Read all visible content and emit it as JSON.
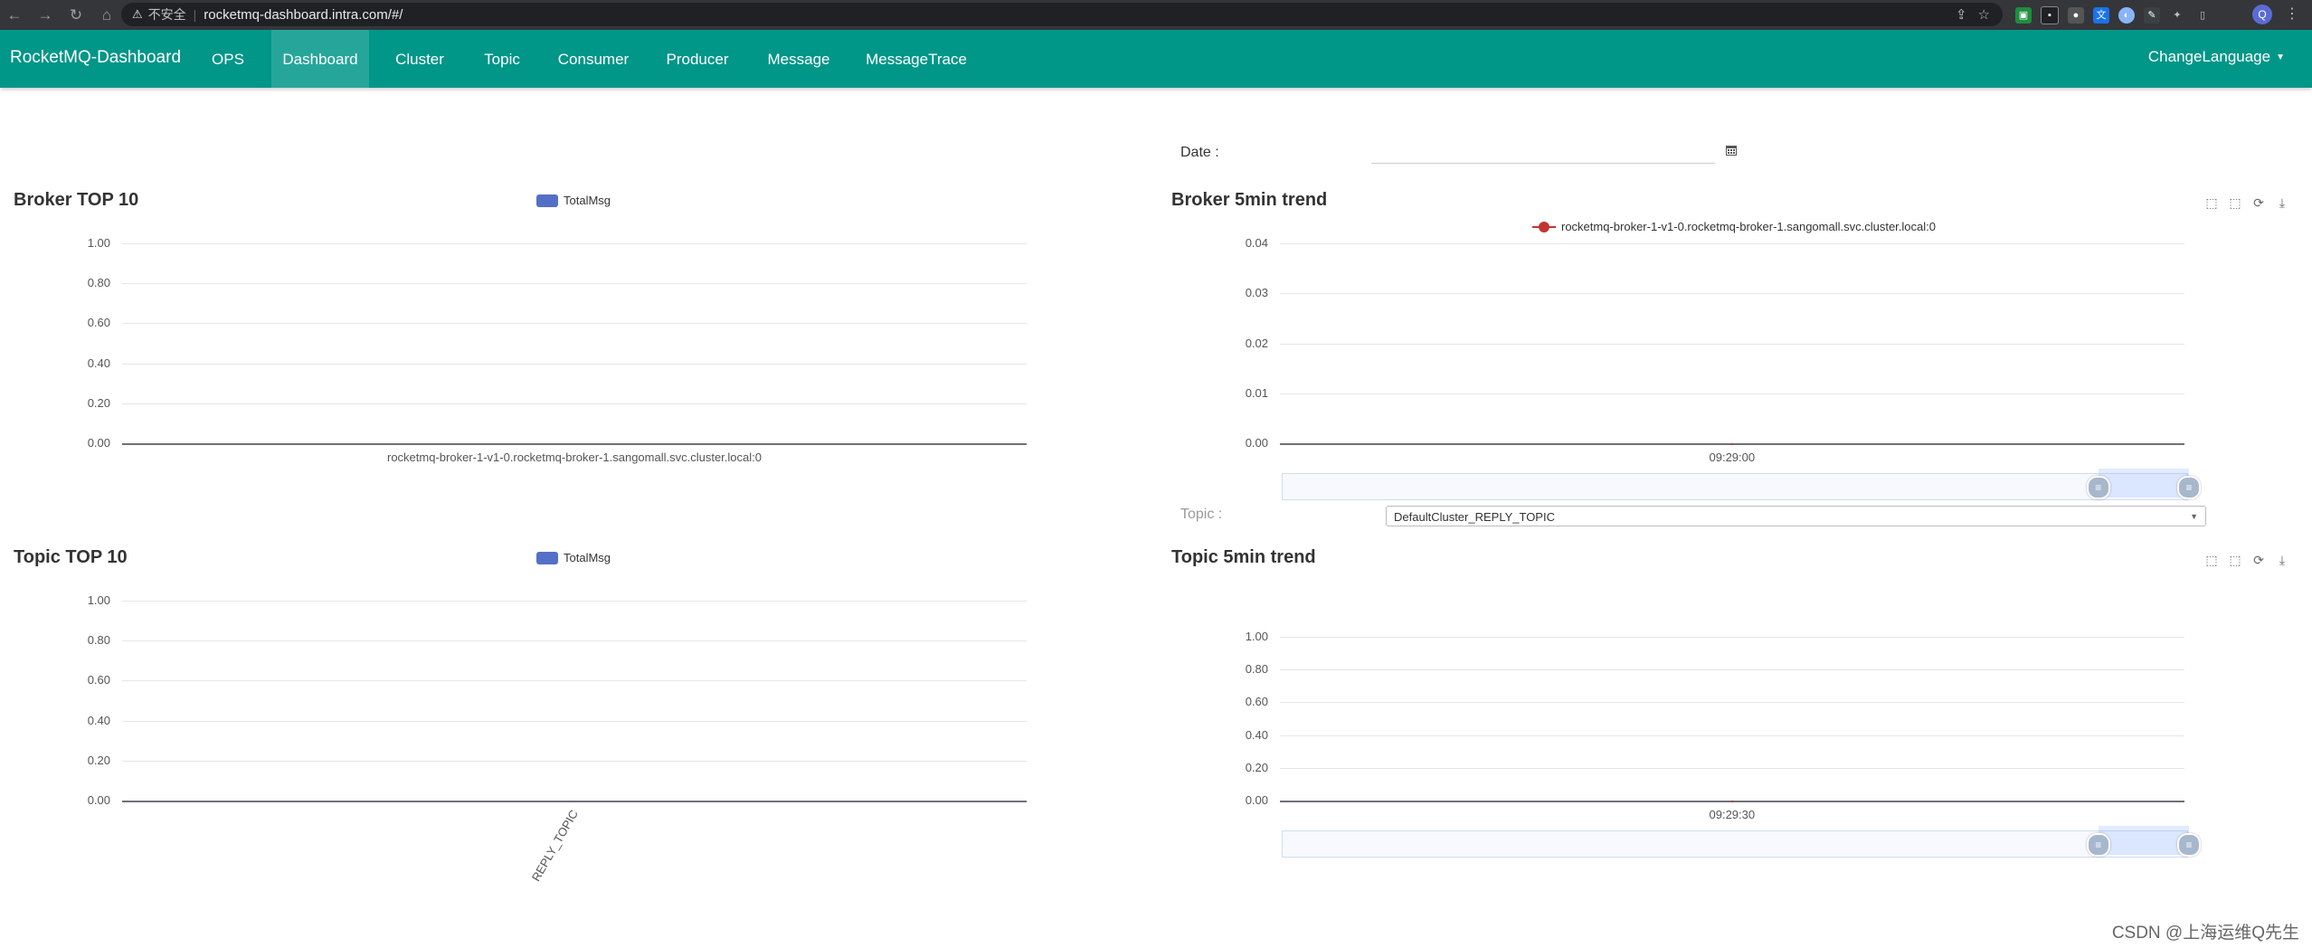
{
  "browser": {
    "insecure_label": "不安全",
    "url": "rocketmq-dashboard.intra.com/#/",
    "profile_initial": "Q"
  },
  "navbar": {
    "brand": "RocketMQ-Dashboard",
    "items": [
      {
        "label": "OPS",
        "active": false
      },
      {
        "label": "Dashboard",
        "active": true
      },
      {
        "label": "Cluster",
        "active": false
      },
      {
        "label": "Topic",
        "active": false
      },
      {
        "label": "Consumer",
        "active": false
      },
      {
        "label": "Producer",
        "active": false
      },
      {
        "label": "Message",
        "active": false
      },
      {
        "label": "MessageTrace",
        "active": false
      }
    ],
    "language": "ChangeLanguage",
    "accent_color": "#009688"
  },
  "date_filter": {
    "label": "Date :",
    "value": ""
  },
  "topic_filter": {
    "label": "Topic :",
    "selected": "DefaultCluster_REPLY_TOPIC"
  },
  "chart_data": [
    {
      "type": "bar",
      "title": "Broker TOP 10",
      "legend": [
        "TotalMsg"
      ],
      "categories": [
        "rocketmq-broker-1-v1-0.rocketmq-broker-1.sangomall.svc.cluster.local:0"
      ],
      "series": [
        {
          "name": "TotalMsg",
          "values": [
            0
          ]
        }
      ],
      "yticks": [
        "1.00",
        "0.80",
        "0.60",
        "0.40",
        "0.20",
        "0.00"
      ],
      "ylim": [
        0,
        1
      ],
      "grid": true,
      "legend_position": "top-center"
    },
    {
      "type": "line",
      "title": "Broker 5min trend",
      "legend": [
        "rocketmq-broker-1-v1-0.rocketmq-broker-1.sangomall.svc.cluster.local:0"
      ],
      "x": [
        "09:29:00"
      ],
      "series": [
        {
          "name": "rocketmq-broker-1-v1-0.rocketmq-broker-1.sangomall.svc.cluster.local:0",
          "values": [
            0
          ]
        }
      ],
      "yticks": [
        "0.04",
        "0.03",
        "0.02",
        "0.01",
        "0.00"
      ],
      "ylim": [
        0,
        0.04
      ],
      "grid": true,
      "legend_position": "top-center",
      "data_zoom": [
        90,
        100
      ]
    },
    {
      "type": "bar",
      "title": "Topic TOP 10",
      "legend": [
        "TotalMsg"
      ],
      "categories": [
        "REPLY_TOPIC"
      ],
      "series": [
        {
          "name": "TotalMsg",
          "values": [
            0
          ]
        }
      ],
      "yticks": [
        "1.00",
        "0.80",
        "0.60",
        "0.40",
        "0.20",
        "0.00"
      ],
      "ylim": [
        0,
        1
      ],
      "grid": true,
      "legend_position": "top-center"
    },
    {
      "type": "line",
      "title": "Topic 5min trend",
      "legend": [],
      "x": [
        "09:29:30"
      ],
      "series": [
        {
          "values": [
            0
          ]
        }
      ],
      "yticks": [
        "1.00",
        "0.80",
        "0.60",
        "0.40",
        "0.20",
        "0.00"
      ],
      "ylim": [
        0,
        1
      ],
      "grid": true,
      "data_zoom": [
        90,
        100
      ]
    }
  ],
  "watermark": "CSDN @上海运维Q先生"
}
